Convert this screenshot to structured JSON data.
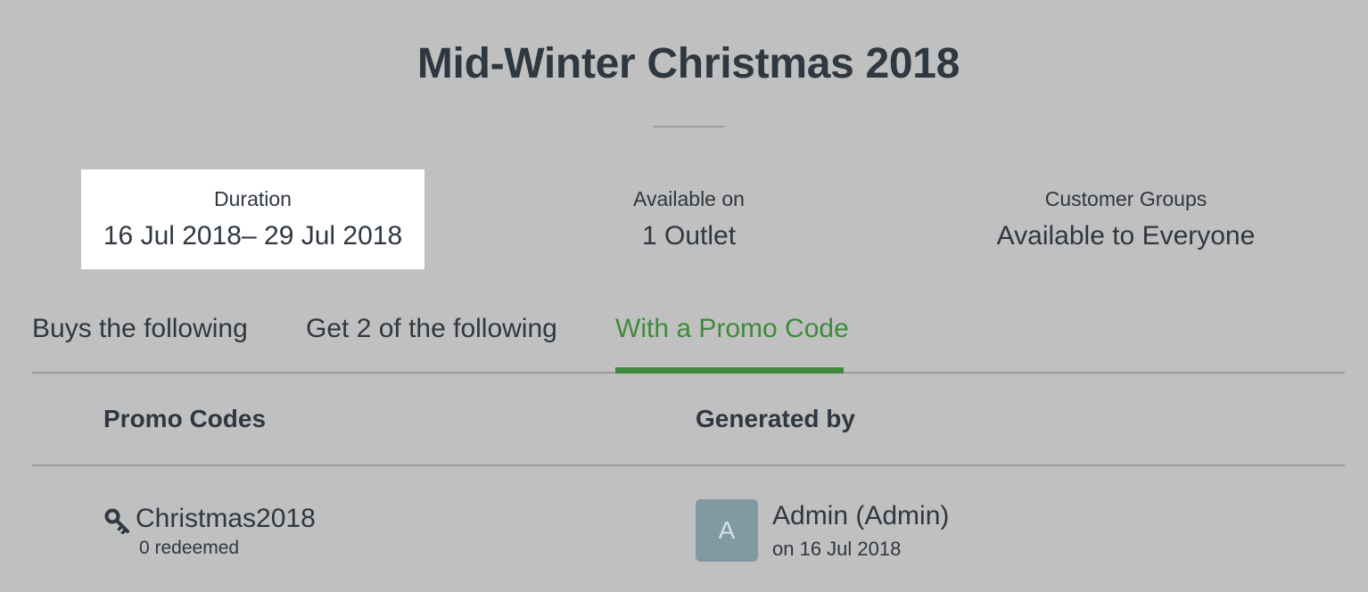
{
  "promotion": {
    "title": "Mid-Winter Christmas 2018"
  },
  "summary": {
    "duration": {
      "label": "Duration",
      "value": "16 Jul 2018– 29 Jul 2018"
    },
    "available_on": {
      "label": "Available on",
      "value": "1 Outlet"
    },
    "customer_groups": {
      "label": "Customer Groups",
      "value": "Available to Everyone"
    }
  },
  "tabs": [
    {
      "label": "Buys the following",
      "active": false
    },
    {
      "label": "Get 2 of the following",
      "active": false
    },
    {
      "label": "With a Promo Code",
      "active": true
    }
  ],
  "promo_table": {
    "headers": {
      "codes": "Promo Codes",
      "generated_by": "Generated by"
    },
    "rows": [
      {
        "icon": "key-icon",
        "code": "Christmas2018",
        "redeemed": "0 redeemed",
        "avatar_initial": "A",
        "generated_by": "Admin (Admin)",
        "generated_on": "on 16 Jul 2018"
      }
    ]
  },
  "colors": {
    "background": "#c0c0c0",
    "text": "#2f3740",
    "active_tab": "#3f8a3c",
    "avatar": "#7f9aa3",
    "highlight_card": "#ffffff"
  }
}
